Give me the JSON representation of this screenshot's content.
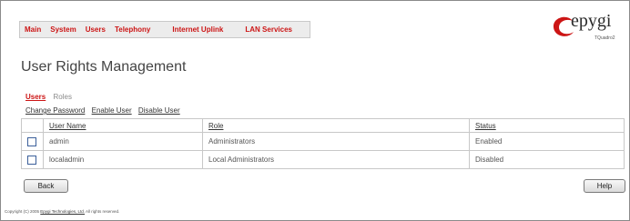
{
  "nav": {
    "items": [
      "Main",
      "System",
      "Users",
      "Telephony",
      "Internet Uplink",
      "LAN Services"
    ]
  },
  "logo": {
    "wordmark": "epygi",
    "model": "TQuadro2"
  },
  "page": {
    "title": "User Rights Management"
  },
  "tabs": {
    "active": "Users",
    "inactive": "Roles"
  },
  "actions": [
    "Change Password",
    "Enable User",
    "Disable User"
  ],
  "table": {
    "headers": [
      "User Name",
      "Role",
      "Status"
    ],
    "rows": [
      {
        "user": "admin",
        "role": "Administrators",
        "status": "Enabled"
      },
      {
        "user": "localadmin",
        "role": "Local Administrators",
        "status": "Disabled"
      }
    ]
  },
  "buttons": {
    "back": "Back",
    "help": "Help"
  },
  "footer": {
    "prefix": "Copyright (C) 2005",
    "company": "Epygi Technologies, Ltd.",
    "suffix": "All rights reserved."
  },
  "colors": {
    "accent": "#cc1515",
    "checkbox_border": "#3b5f9a"
  }
}
